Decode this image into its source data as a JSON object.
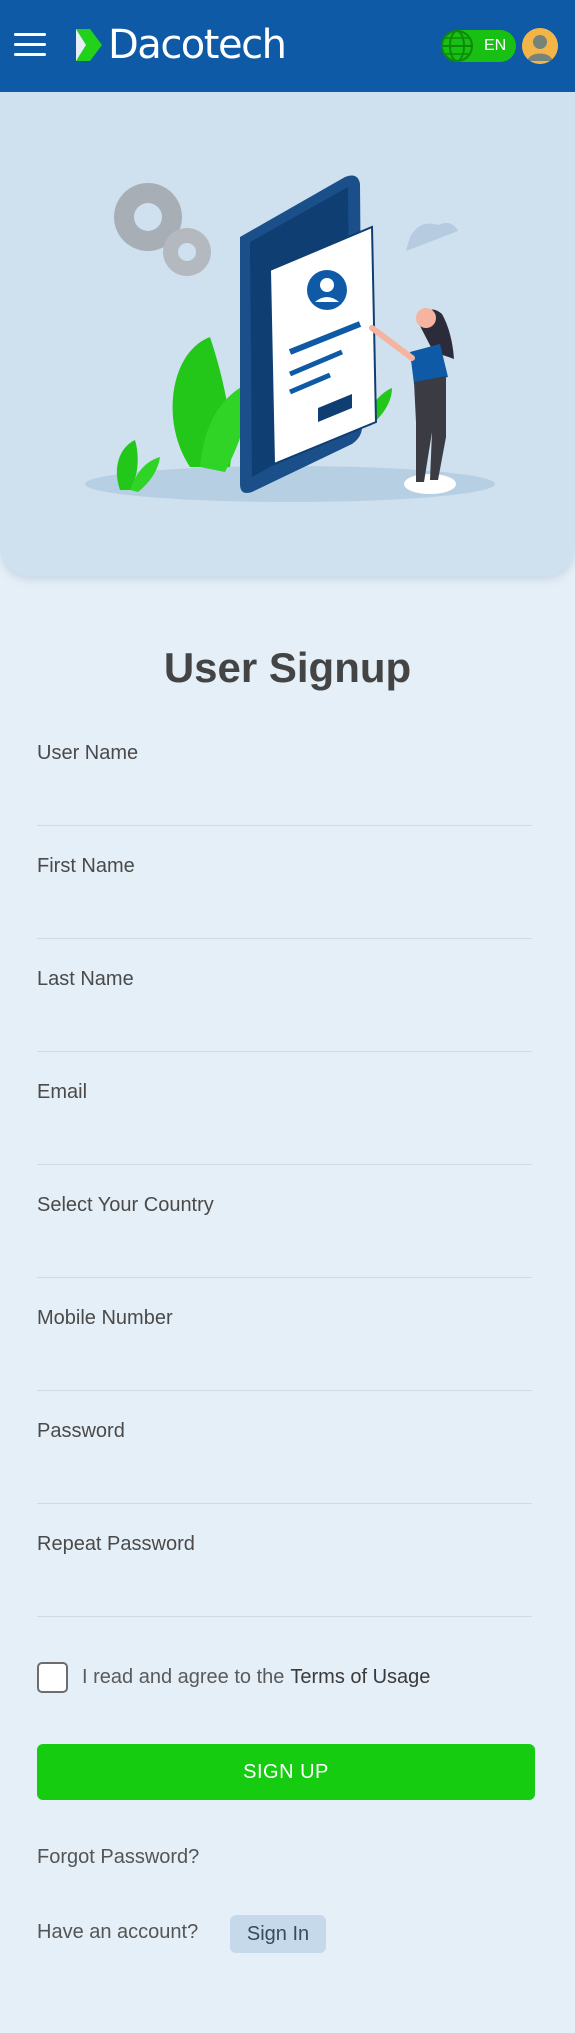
{
  "header": {
    "brand": "Dacotech",
    "language": "EN",
    "accent": "#0e5aa6",
    "icons": [
      "hamburger-menu-icon",
      "globe-icon",
      "user-avatar-icon"
    ]
  },
  "page": {
    "title": "User Signup"
  },
  "form": {
    "fields": [
      {
        "label": "User Name",
        "value": ""
      },
      {
        "label": "First Name",
        "value": ""
      },
      {
        "label": "Last Name",
        "value": ""
      },
      {
        "label": "Email",
        "value": ""
      },
      {
        "label": "Select Your Country",
        "value": ""
      },
      {
        "label": "Mobile Number",
        "value": ""
      },
      {
        "label": "Password",
        "value": ""
      },
      {
        "label": "Repeat Password",
        "value": ""
      }
    ],
    "terms_text": "I read and agree to the",
    "terms_link": "Terms of Usage",
    "submit_label": "SIGN UP",
    "submit_color": "#16cc10"
  },
  "footer": {
    "forgot_password": "Forgot Password?",
    "have_account": "Have an account?",
    "sign_in": "Sign In"
  }
}
